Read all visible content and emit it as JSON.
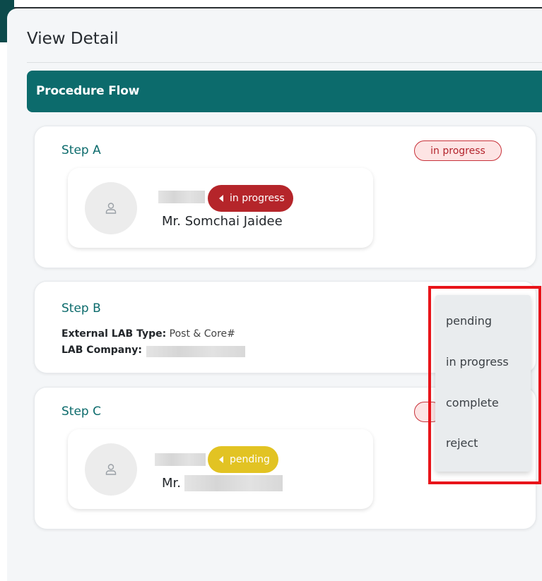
{
  "page": {
    "title": "View Detail",
    "section_header": "Procedure Flow"
  },
  "steps": [
    {
      "name": "Step A",
      "status": "in progress",
      "assignee": {
        "tag": "in progress",
        "name": "Mr. Somchai Jaidee"
      }
    },
    {
      "name": "Step B",
      "external_lab_type_label": "External LAB Type:",
      "external_lab_type_value": "Post & Core#",
      "lab_company_label": "LAB Company:"
    },
    {
      "name": "Step C",
      "assignee": {
        "tag": "pending",
        "name_prefix": "Mr."
      }
    }
  ],
  "status_menu": {
    "options": [
      "pending",
      "in progress",
      "complete",
      "reject"
    ]
  },
  "colors": {
    "teal": "#0c6b6c",
    "in_progress_tag": "#b5252a",
    "pending_tag": "#e2c323",
    "highlight_box": "#e8141a"
  },
  "icons": {
    "avatar": "user-icon",
    "tag_caret": "caret-left-icon"
  }
}
